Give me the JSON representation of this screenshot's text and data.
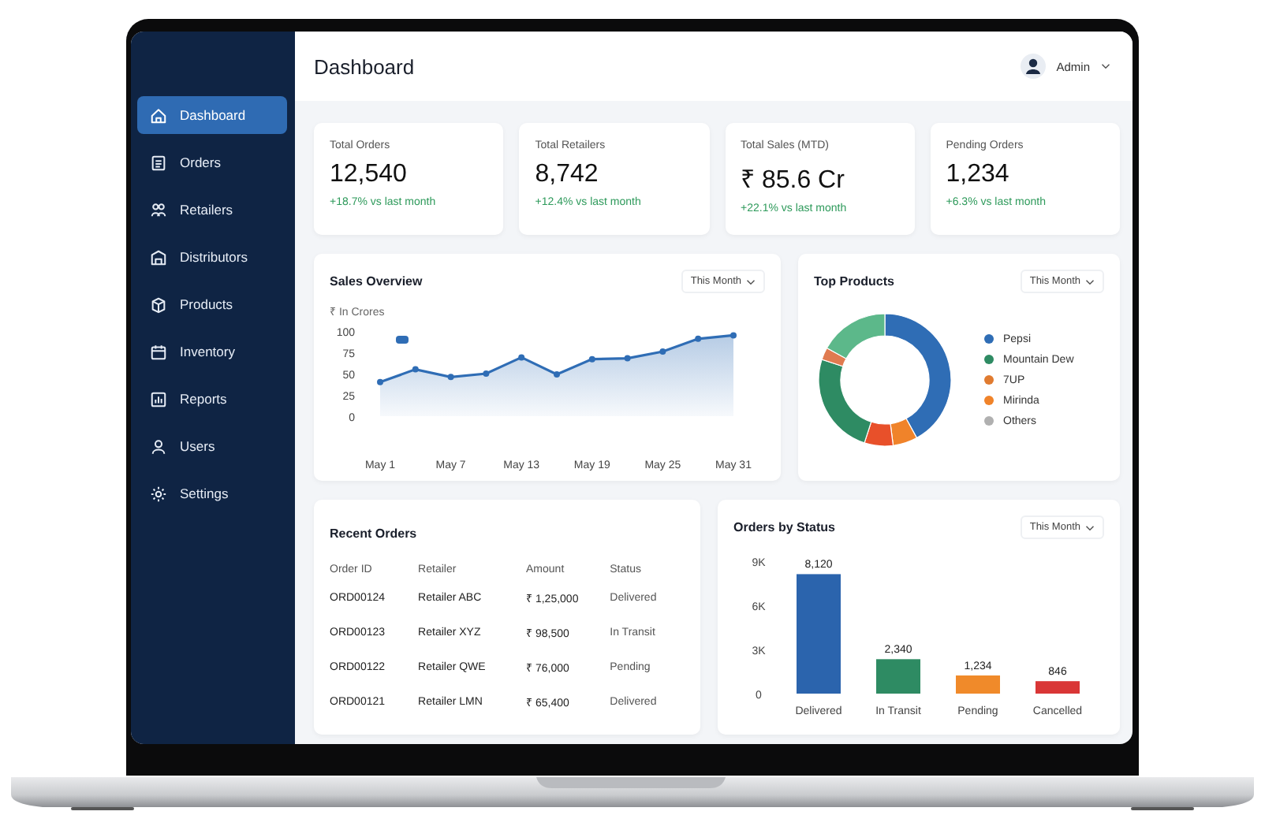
{
  "header": {
    "title": "Dashboard",
    "user": "Admin"
  },
  "sidebar": {
    "items": [
      {
        "label": "Dashboard",
        "selected": true
      },
      {
        "label": "Orders",
        "selected": false
      },
      {
        "label": "Retailers",
        "selected": false
      },
      {
        "label": "Distributors",
        "selected": false
      },
      {
        "label": "Products",
        "selected": false
      },
      {
        "label": "Inventory",
        "selected": false
      },
      {
        "label": "Reports",
        "selected": false
      },
      {
        "label": "Users",
        "selected": false
      },
      {
        "label": "Settings",
        "selected": false
      }
    ]
  },
  "stats": [
    {
      "label": "Total Orders",
      "value": "12,540",
      "change": "+18.7% vs last month"
    },
    {
      "label": "Total Retailers",
      "value": "8,742",
      "change": "+12.4% vs last month"
    },
    {
      "label": "Total Sales (MTD)",
      "value": "₹ 85.6 Cr",
      "change": "+22.1% vs last month"
    },
    {
      "label": "Pending Orders",
      "value": "1,234",
      "change": "+6.3% vs last month"
    }
  ],
  "sales_overview": {
    "title": "Sales Overview",
    "filter": "This Month",
    "chart_data": {
      "type": "area",
      "ylabel": "₹ In Crores",
      "categories": [
        "May 1",
        null,
        "May 7",
        null,
        "May 13",
        null,
        "May 19",
        null,
        "May 25",
        null,
        "May 31"
      ],
      "ylim": [
        0,
        100
      ],
      "yticks": [
        0,
        25,
        50,
        75,
        100
      ],
      "series": [
        {
          "color": "#2f6db5",
          "values": [
            40,
            55,
            46,
            50,
            69,
            49,
            67,
            68,
            76,
            91,
            95
          ]
        }
      ]
    }
  },
  "top_products": {
    "title": "Top Products",
    "filter": "This Month",
    "legend": [
      {
        "label": "Pepsi",
        "color": "#2f6db5"
      },
      {
        "label": "Mountain Dew",
        "color": "#2e8b63"
      },
      {
        "label": "7UP",
        "color": "#e07b30"
      },
      {
        "label": "Mirinda",
        "color": "#f0832a"
      },
      {
        "label": "Others",
        "color": "#b0b0b0"
      }
    ]
  },
  "recent_orders": {
    "title": "Recent Orders",
    "columns": [
      "Order ID",
      "Retailer",
      "Amount",
      "Status"
    ],
    "rows": [
      [
        "ORD00124",
        "Retailer ABC",
        "₹ 1,25,000",
        "Delivered"
      ],
      [
        "ORD00123",
        "Retailer XYZ",
        "₹ 98,500",
        "In Transit"
      ],
      [
        "ORD00122",
        "Retailer QWE",
        "₹ 76,000",
        "Pending"
      ],
      [
        "ORD00121",
        "Retailer LMN",
        "₹ 65,400",
        "Delivered"
      ]
    ]
  },
  "orders_by_status": {
    "title": "Orders by Status",
    "filter": "This Month",
    "chart_data": {
      "type": "bar",
      "categories": [
        "Delivered",
        "In Transit",
        "Pending",
        "Cancelled"
      ],
      "ylim": [
        0,
        9000
      ],
      "yticks": [
        {
          "value": 0,
          "label": "0"
        },
        {
          "value": 3000,
          "label": "3K"
        },
        {
          "value": 6000,
          "label": "6K"
        },
        {
          "value": 9000,
          "label": "9K"
        }
      ],
      "stacked": true,
      "series": [
        {
          "color": "#2b64ad",
          "values": [
            8120,
            null,
            null,
            null
          ],
          "value_labels": [
            "8,120",
            null,
            null,
            null
          ]
        },
        {
          "color": "#2e8b63",
          "values": [
            null,
            2340,
            null,
            null
          ],
          "value_labels": [
            null,
            "2,340",
            null,
            null
          ]
        },
        {
          "color": "#f08a2a",
          "values": [
            null,
            null,
            1234,
            null
          ],
          "value_labels": [
            null,
            null,
            "1,234",
            null
          ]
        },
        {
          "color": "#d93636",
          "values": [
            null,
            null,
            null,
            846
          ],
          "value_labels": [
            null,
            null,
            null,
            "846"
          ]
        }
      ]
    }
  }
}
